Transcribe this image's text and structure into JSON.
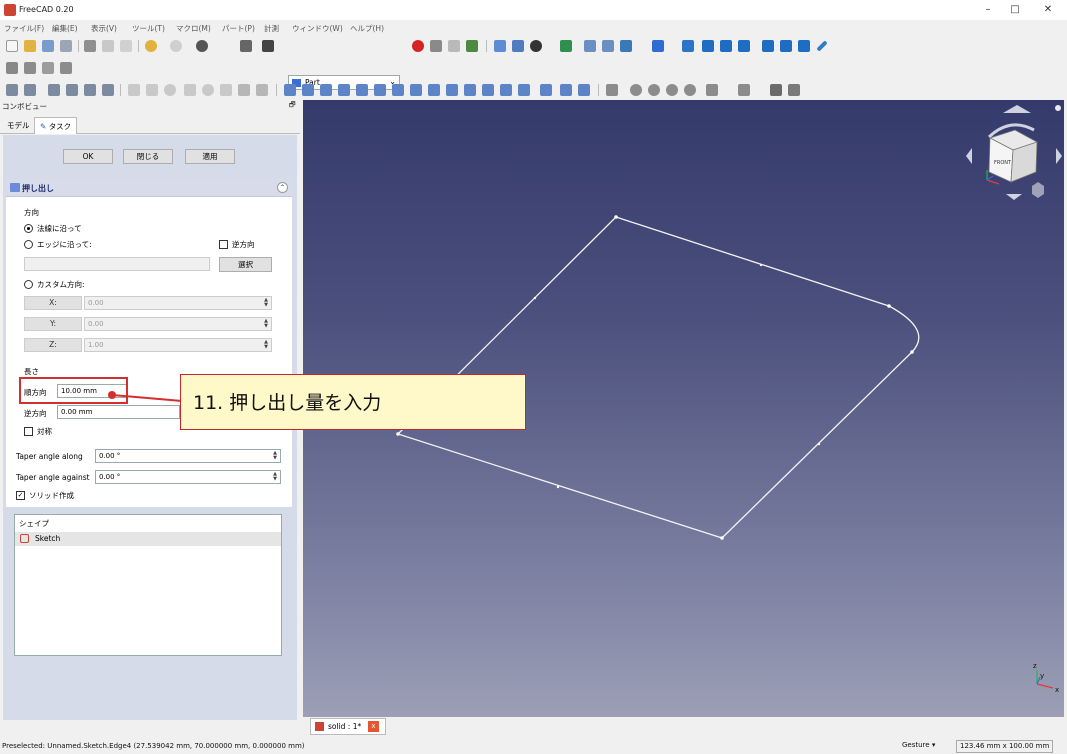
{
  "window": {
    "title": "FreeCAD 0.20",
    "controls": [
      "–",
      "□",
      "✕"
    ]
  },
  "menu": [
    "ファイル(F)",
    "編集(E)",
    "表示(V)",
    "ツール(T)",
    "マクロ(M)",
    "パート(P)",
    "計測",
    "ウィンドウ(W)",
    "ヘルプ(H)"
  ],
  "toolbar": {
    "workbench": "Part"
  },
  "combo": {
    "title": "コンボビュー",
    "undock": "🗗",
    "tabs": [
      "モデル",
      "タスク"
    ],
    "buttons": {
      "ok": "OK",
      "close": "閉じる",
      "apply": "適用"
    }
  },
  "extrude": {
    "title": "押し出し",
    "direction_label": "方向",
    "along_normal": "法線に沿って",
    "along_edge": "エッジに沿って:",
    "reversed": "逆方向",
    "select_button": "選択",
    "custom_direction": "カスタム方向:",
    "x_label": "X:",
    "x_value": "0.00",
    "y_label": "Y:",
    "y_value": "0.00",
    "z_label": "Z:",
    "z_value": "1.00",
    "length_label": "長さ",
    "forward_label": "順方向",
    "forward_value": "10.00 mm",
    "reverse_label": "逆方向",
    "reverse_value": "0.00 mm",
    "symmetric": "対称",
    "taper_along_label": "Taper angle along",
    "taper_along_value": "0.00 °",
    "taper_against_label": "Taper angle against",
    "taper_against_value": "0.00 °",
    "create_solid": "ソリッド作成",
    "shape_header": "シェイプ",
    "shape_item": "Sketch"
  },
  "view": {
    "navcube_label": "FRONT",
    "axis_x": "x",
    "axis_y": "y",
    "axis_z": "z"
  },
  "doc_tab": {
    "label": "solid : 1*",
    "close": "x"
  },
  "status": {
    "preselected": "Preselected: Unnamed.Sketch.Edge4 (27.539042 mm, 70.000000 mm, 0.000000 mm)",
    "nav_style": "Gesture ▾",
    "dimensions": "123.46 mm x 100.00 mm"
  },
  "callout": {
    "text": "11. 押し出し量を入力"
  }
}
